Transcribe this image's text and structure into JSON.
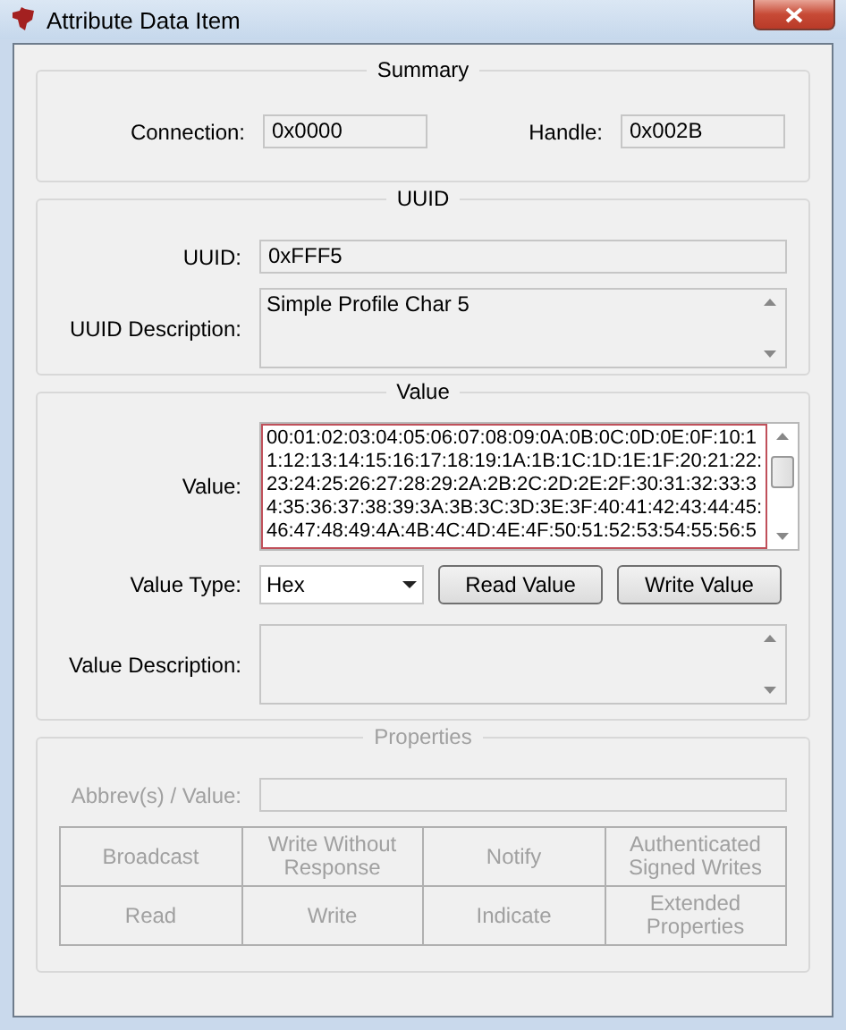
{
  "window": {
    "title": "Attribute Data Item"
  },
  "summary": {
    "title": "Summary",
    "connection_label": "Connection:",
    "connection": "0x0000",
    "handle_label": "Handle:",
    "handle": "0x002B"
  },
  "uuid": {
    "title": "UUID",
    "uuid_label": "UUID:",
    "uuid": "0xFFF5",
    "description_label": "UUID Description:",
    "description": "Simple Profile Char 5"
  },
  "value": {
    "title": "Value",
    "value_label": "Value:",
    "value": "00:01:02:03:04:05:06:07:08:09:0A:0B:0C:0D:0E:0F:10:1\n1:12:13:14:15:16:17:18:19:1A:1B:1C:1D:1E:1F:20:21:22:\n23:24:25:26:27:28:29:2A:2B:2C:2D:2E:2F:30:31:32:33:3\n4:35:36:37:38:39:3A:3B:3C:3D:3E:3F:40:41:42:43:44:45:\n46:47:48:49:4A:4B:4C:4D:4E:4F:50:51:52:53:54:55:56:5",
    "type_label": "Value Type:",
    "type": "Hex",
    "buttons": [
      "Read Value",
      "Write Value"
    ],
    "description_label": "Value Description:"
  },
  "properties": {
    "title": "Properties",
    "disabled": true,
    "abbrev_label": "Abbrev(s) / Value:",
    "grid": [
      [
        "Broadcast",
        "Write Without Response",
        "Notify",
        "Authenticated Signed Writes"
      ],
      [
        "Read",
        "Write",
        "Indicate",
        "Extended Properties"
      ]
    ]
  }
}
